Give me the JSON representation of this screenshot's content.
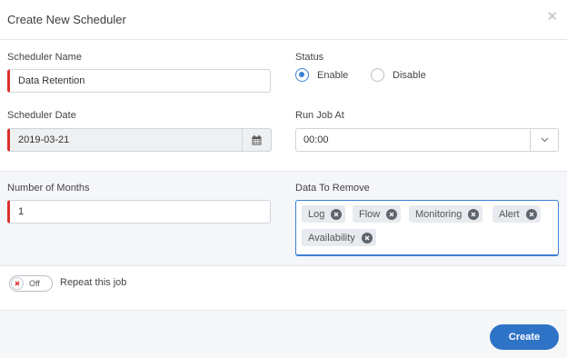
{
  "dialog": {
    "title": "Create New Scheduler",
    "close_icon": "close-icon"
  },
  "form": {
    "scheduler_name": {
      "label": "Scheduler Name",
      "value": "Data Retention"
    },
    "status": {
      "label": "Status",
      "options": [
        {
          "label": "Enable",
          "selected": true
        },
        {
          "label": "Disable",
          "selected": false
        }
      ]
    },
    "scheduler_date": {
      "label": "Scheduler Date",
      "value": "2019-03-21",
      "icon": "calendar-icon"
    },
    "run_job_at": {
      "label": "Run Job At",
      "value": "00:00",
      "icon": "chevron-down-icon"
    },
    "number_of_months": {
      "label": "Number of Months",
      "value": "1"
    },
    "data_to_remove": {
      "label": "Data To Remove",
      "tags": [
        "Log",
        "Flow",
        "Monitoring",
        "Alert",
        "Availability"
      ]
    },
    "repeat": {
      "toggle_state": "Off",
      "label": "Repeat this job"
    }
  },
  "footer": {
    "create_label": "Create"
  },
  "colors": {
    "accent": "#2f73c7",
    "required_marker": "#d9302c",
    "radio_selected": "#3a7fd5"
  }
}
